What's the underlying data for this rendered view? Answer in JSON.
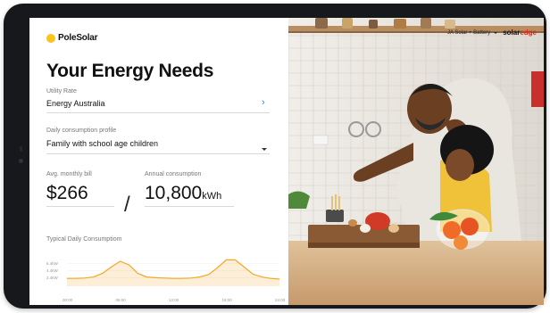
{
  "brand": {
    "name": "PoleSolar",
    "accent_color": "#f7c51b"
  },
  "page": {
    "title": "Your Energy Needs"
  },
  "utility": {
    "label": "Utility Rate",
    "value": "Energy Australia"
  },
  "profile": {
    "label": "Daily consumption profile",
    "value": "Family with school age children"
  },
  "bill": {
    "label": "Avg. monthly bill",
    "value": "$266"
  },
  "consumption": {
    "label": "Annual consumption",
    "value": "10,800",
    "unit": "kWh"
  },
  "header": {
    "plan": "JA Solar + Battery",
    "partner_brand_main": "solar",
    "partner_brand_accent": "edge"
  },
  "chart_data": {
    "type": "area",
    "title": "Typical Daily Consumptiom",
    "x_ticks": [
      "00:00",
      "06:00",
      "12:00",
      "18:00",
      "24:00"
    ],
    "y_ticks": [
      "2.4kW",
      "4.4kW",
      "6.4kW"
    ],
    "x": [
      0,
      1,
      2,
      3,
      4,
      5,
      6,
      7,
      8,
      9,
      10,
      11,
      12,
      13,
      14,
      15,
      16,
      17,
      18,
      19,
      20,
      21,
      22,
      23,
      24
    ],
    "values": [
      2.2,
      2.2,
      2.3,
      2.6,
      3.6,
      5.4,
      7.0,
      6.0,
      3.6,
      2.6,
      2.4,
      2.3,
      2.2,
      2.2,
      2.3,
      2.6,
      3.3,
      5.2,
      7.4,
      7.4,
      5.4,
      3.4,
      2.6,
      2.2,
      2.0
    ],
    "ylim": [
      0,
      10
    ],
    "color": "#f5a623"
  }
}
